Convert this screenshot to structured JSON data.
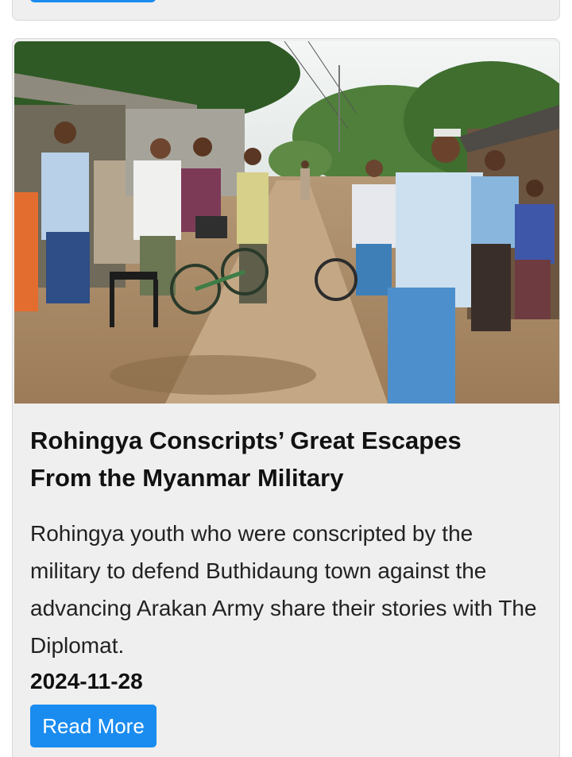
{
  "article": {
    "title_line1": "Rohingya Conscripts’ Great Escapes",
    "title_line2": "From the Myanmar Military",
    "summary": "Rohingya youth who were conscripted by the military to defend Buthidaung town against the advancing Arakan Army share their stories with The Diplomat.",
    "date": "2024-11-28",
    "read_more_label": "Read More"
  },
  "colors": {
    "card_background": "#efefef",
    "button_blue": "#1a8cf0",
    "text": "#111111"
  }
}
